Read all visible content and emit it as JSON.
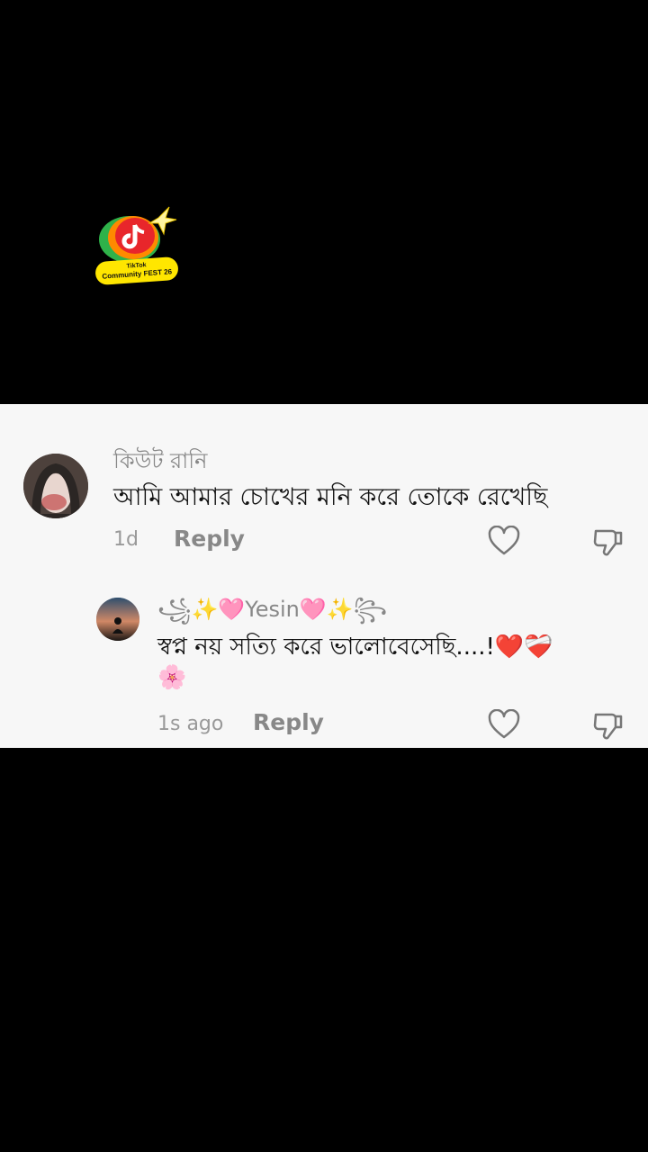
{
  "logo": {
    "line1": "TikTok",
    "line2": "Community FEST 26"
  },
  "comments": [
    {
      "username": "কিউট রানি",
      "text": "আমি আমার চোখের মনি করে তোকে রেখেছি",
      "time": "1d",
      "reply_label": "Reply"
    },
    {
      "username": "꧁✨🩷Yesin🩷✨꧂",
      "text": "স্বপ্ন নয় সত্যি করে ভালোবেসেছি....!❤️❤️‍🩹",
      "text_line2": "🌸",
      "time": "1s ago",
      "reply_label": "Reply"
    }
  ],
  "colors": {
    "panel": "#f7f7f7",
    "username": "#888888",
    "accent_logo": "#ffe600"
  }
}
